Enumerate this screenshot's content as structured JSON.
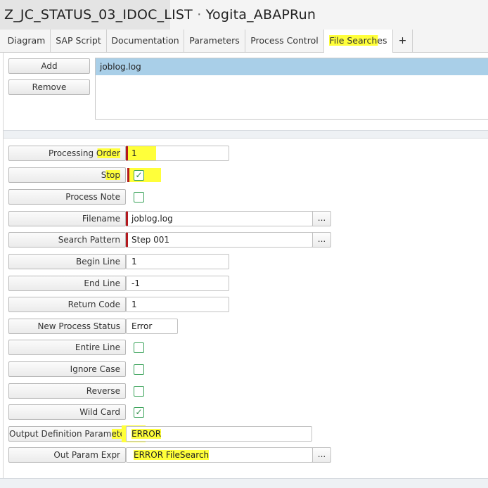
{
  "title": {
    "job_name": "Z_JC_STATUS_03_IDOC_LIST",
    "separator": "·",
    "owner": "Yogita_ABAPRun"
  },
  "tabs": [
    {
      "label": "Diagram",
      "active": false
    },
    {
      "label": "SAP Script",
      "active": false
    },
    {
      "label": "Documentation",
      "active": false
    },
    {
      "label": "Parameters",
      "active": false
    },
    {
      "label": "Process Control",
      "active": false
    },
    {
      "label": "File Searches",
      "active": true
    },
    {
      "label": "+",
      "active": false
    }
  ],
  "file_list": {
    "add_label": "Add",
    "remove_label": "Remove",
    "items": [
      "joblog.log"
    ],
    "selected_index": 0
  },
  "form": {
    "processing_order": {
      "label": "Processing Order",
      "value": "1"
    },
    "stop": {
      "label": "Stop",
      "checked": true
    },
    "process_note": {
      "label": "Process Note",
      "checked": false
    },
    "filename": {
      "label": "Filename",
      "value": "joblog.log",
      "button": "..."
    },
    "search_pattern": {
      "label": "Search Pattern",
      "value": "Step 001",
      "button": "..."
    },
    "begin_line": {
      "label": "Begin Line",
      "value": "1"
    },
    "end_line": {
      "label": "End Line",
      "value": "-1"
    },
    "return_code": {
      "label": "Return Code",
      "value": "1"
    },
    "new_process_status": {
      "label": "New Process Status",
      "value": "Error"
    },
    "entire_line": {
      "label": "Entire Line",
      "checked": false
    },
    "ignore_case": {
      "label": "Ignore Case",
      "checked": false
    },
    "reverse": {
      "label": "Reverse",
      "checked": false
    },
    "wild_card": {
      "label": "Wild Card",
      "checked": true
    },
    "output_definition_parameter": {
      "label": "Output Definition Parameter",
      "value": "ERROR"
    },
    "out_param_expr": {
      "label": "Out Param Expr",
      "value": "ERROR FileSearch",
      "button": "..."
    }
  },
  "colors": {
    "highlight": "#ffff3a",
    "selection": "#a9cfe8",
    "required_marker": "#b3191e",
    "checkbox": "#3ba35a"
  }
}
